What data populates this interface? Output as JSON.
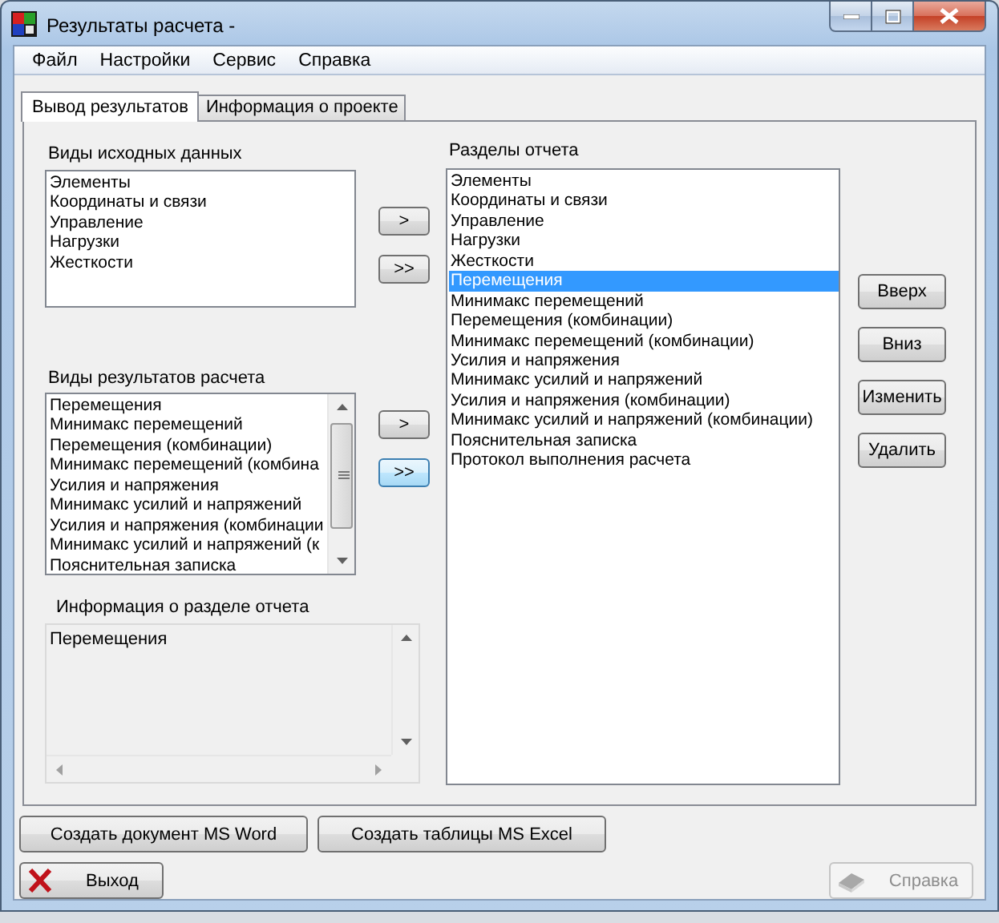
{
  "window": {
    "title": "Результаты расчета -"
  },
  "menu": [
    "Файл",
    "Настройки",
    "Сервис",
    "Справка"
  ],
  "tabs": [
    {
      "label": "Вывод результатов",
      "selected": true
    },
    {
      "label": "Информация о проекте",
      "selected": false
    }
  ],
  "source_data": {
    "label": "Виды исходных данных",
    "items": [
      "Элементы",
      "Координаты и связи",
      "Управление",
      "Нагрузки",
      "Жесткости"
    ]
  },
  "result_types": {
    "label": "Виды результатов расчета",
    "items": [
      "Перемещения",
      "Минимакс перемещений",
      "Перемещения (комбинации)",
      "Минимакс перемещений (комбина",
      "Усилия и напряжения",
      "Минимакс усилий и напряжений",
      "Усилия и напряжения (комбинации",
      "Минимакс усилий и напряжений (к",
      "Пояснительная записка"
    ]
  },
  "transfer_buttons": [
    {
      "label": ">",
      "focused": false
    },
    {
      "label": ">>",
      "focused": false
    },
    {
      "label": ">",
      "focused": false
    },
    {
      "label": ">>",
      "focused": true
    }
  ],
  "section_info": {
    "label": "Информация о разделе отчета",
    "text": "Перемещения"
  },
  "report_sections": {
    "label": "Разделы отчета",
    "items": [
      {
        "label": "Элементы",
        "selected": false
      },
      {
        "label": "Координаты и связи",
        "selected": false
      },
      {
        "label": "Управление",
        "selected": false
      },
      {
        "label": "Нагрузки",
        "selected": false
      },
      {
        "label": "Жесткости",
        "selected": false
      },
      {
        "label": "Перемещения",
        "selected": true
      },
      {
        "label": "Минимакс перемещений",
        "selected": false
      },
      {
        "label": "Перемещения (комбинации)",
        "selected": false
      },
      {
        "label": "Минимакс перемещений (комбинации)",
        "selected": false
      },
      {
        "label": "Усилия и напряжения",
        "selected": false
      },
      {
        "label": "Минимакс усилий и напряжений",
        "selected": false
      },
      {
        "label": "Усилия и напряжения (комбинации)",
        "selected": false
      },
      {
        "label": "Минимакс усилий и напряжений (комбинации)",
        "selected": false
      },
      {
        "label": "Пояснительная записка",
        "selected": false
      },
      {
        "label": "Протокол выполнения расчета",
        "selected": false
      }
    ]
  },
  "section_buttons": [
    "Вверх",
    "Вниз",
    "Изменить",
    "Удалить"
  ],
  "export_buttons": [
    "Создать документ MS Word",
    "Создать таблицы MS Excel"
  ],
  "exit_button": {
    "label": "Выход"
  },
  "help_button": {
    "label": "Справка",
    "disabled": true
  }
}
